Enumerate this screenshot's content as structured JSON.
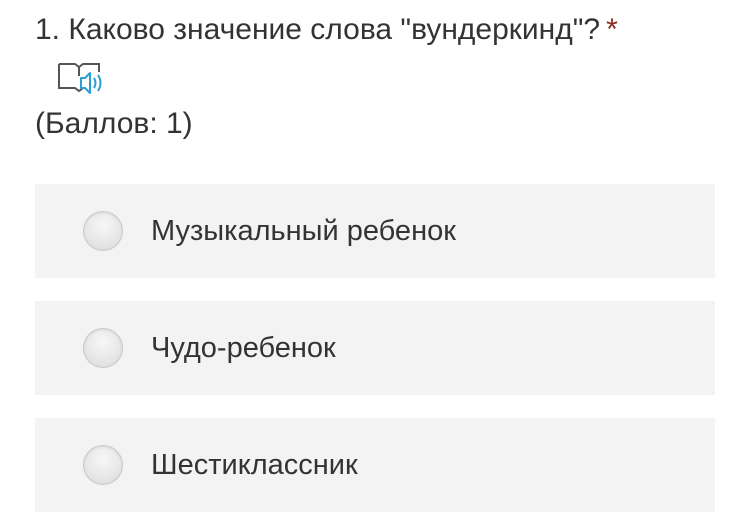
{
  "question": {
    "number_text": "1. Каково значение слова \"вундеркинд\"?",
    "required_mark": "*",
    "points": "(Баллов: 1)"
  },
  "icons": {
    "reader": "book-speaker-icon",
    "radio": "radio-unchecked-icon"
  },
  "colors": {
    "required": "#8b2a1e",
    "option_bg": "#f3f3f3",
    "speaker": "#2a9fd6"
  },
  "options": [
    {
      "label": "Музыкальный ребенок"
    },
    {
      "label": "Чудо-ребенок"
    },
    {
      "label": "Шестиклассник"
    }
  ]
}
